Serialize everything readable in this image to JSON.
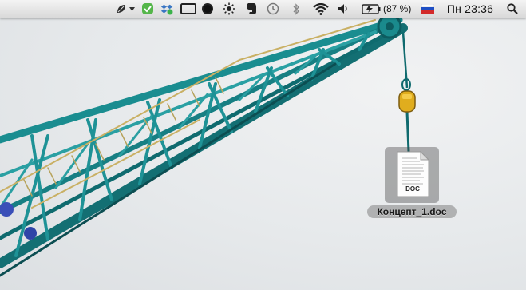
{
  "menubar": {
    "battery_percent_text": "(87 %)",
    "input_source": "Russian flag",
    "clock_text": "Пн 23:36",
    "icons": [
      "leaf-icon",
      "chevron-down-icon",
      "evernote-sync-icon",
      "dropbox-icon",
      "display-icon",
      "record-icon",
      "brightness-icon",
      "evernote-icon",
      "time-machine-icon",
      "bluetooth-icon",
      "wifi-icon",
      "volume-icon",
      "battery-icon",
      "flag-icon",
      "spotlight-icon"
    ]
  },
  "desktop": {
    "wallpaper": "teal construction crane arm against pale sky",
    "file": {
      "type_badge": "DOC",
      "name": "Концепт_1.doc"
    }
  },
  "colors": {
    "crane": "#1d8c8e",
    "crane_dark": "#0f5f63",
    "sky": "#e9ebec"
  }
}
